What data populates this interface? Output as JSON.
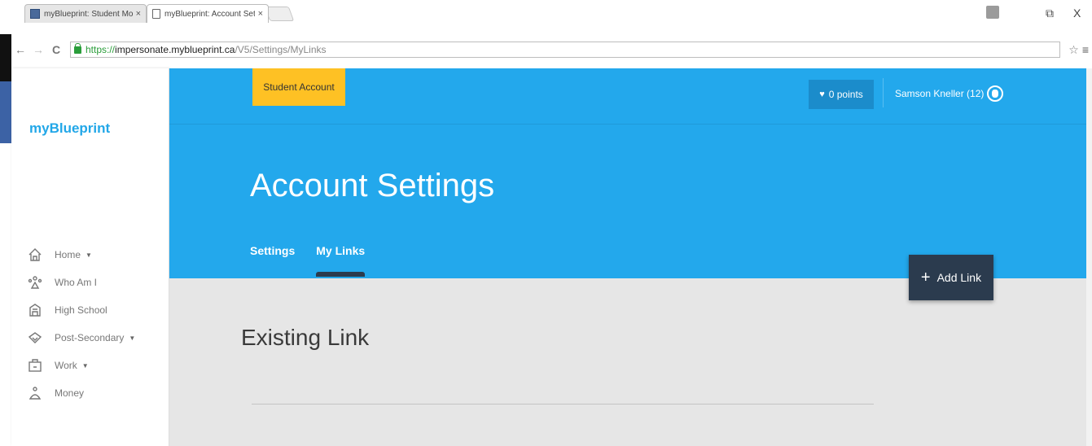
{
  "browser": {
    "tabs": [
      {
        "title": "myBlueprint: Student Mo",
        "close": "×",
        "active": false
      },
      {
        "title": "myBlueprint: Account Sett",
        "close": "×",
        "active": true
      }
    ],
    "window_controls": {
      "restore": "⧉",
      "close": "X"
    },
    "nav": {
      "back": "←",
      "forward": "→",
      "reload": "C"
    },
    "url": {
      "scheme": "https://",
      "host": "impersonate.myblueprint.ca",
      "path": "/V5/Settings/MyLinks"
    },
    "bookmark_star": "☆",
    "menu": "≡"
  },
  "sidebar": {
    "logo": "myBlueprint",
    "items": [
      {
        "label": "Home",
        "icon": "home-icon",
        "has_dropdown": true
      },
      {
        "label": "Who Am I",
        "icon": "people-icon",
        "has_dropdown": false
      },
      {
        "label": "High School",
        "icon": "school-icon",
        "has_dropdown": false
      },
      {
        "label": "Post-Secondary",
        "icon": "diploma-icon",
        "has_dropdown": true
      },
      {
        "label": "Work",
        "icon": "briefcase-icon",
        "has_dropdown": true
      },
      {
        "label": "Money",
        "icon": "money-icon",
        "has_dropdown": false
      }
    ],
    "caret": "▼"
  },
  "header": {
    "badge": "Student Account",
    "points": "0 points",
    "user": "Samson Kneller (12)",
    "title": "Account Settings",
    "tabs": [
      {
        "label": "Settings",
        "active": false
      },
      {
        "label": "My Links",
        "active": true
      }
    ]
  },
  "main": {
    "add_link_label": "Add Link",
    "add_link_plus": "+",
    "section_title": "Existing Link"
  },
  "colors": {
    "header_blue": "#23a8ec",
    "badge_yellow": "#fec124",
    "dark_navy": "#2b3b4e",
    "body_gray": "#e6e6e6",
    "logo_blue": "#22a7e8"
  }
}
